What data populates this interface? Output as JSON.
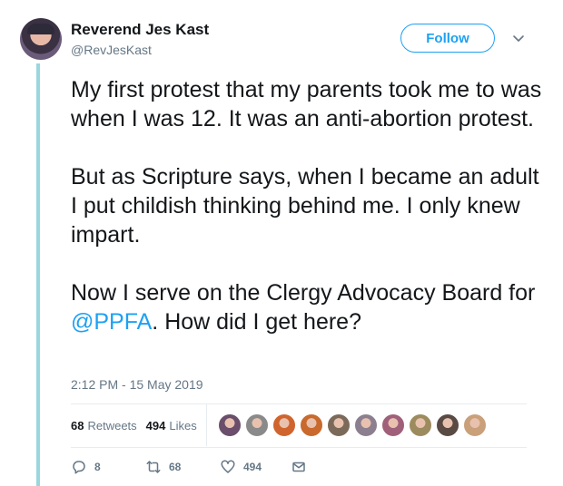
{
  "author": {
    "display_name": "Reverend Jes Kast",
    "handle": "@RevJesKast"
  },
  "follow_label": "Follow",
  "tweet": {
    "para1": "My first protest that my parents took me to was when I was 12. It was an anti-abortion protest.",
    "para2": "But as Scripture says, when I became an adult I put childish thinking behind me. I only knew impart.",
    "para3_before": "Now I serve on the Clergy Advocacy Board for ",
    "mention": "@PPFA",
    "para3_after": ". How did I get here?"
  },
  "timestamp": "2:12 PM - 15 May 2019",
  "stats": {
    "retweets_count": "68",
    "retweets_label": "Retweets",
    "likes_count": "494",
    "likes_label": "Likes"
  },
  "actions": {
    "replies": "8",
    "retweets": "68",
    "likes": "494"
  },
  "colors": {
    "accent": "#1da1f2",
    "thread_line": "#9ad7df",
    "muted": "#657786"
  },
  "liker_avatars": [
    "#6a4e6b",
    "#8a8a8a",
    "#d0642e",
    "#c9692d",
    "#7b6a5a",
    "#8c7f8f",
    "#a0607a",
    "#9c8b5e",
    "#5a4a44",
    "#c9a07a"
  ]
}
